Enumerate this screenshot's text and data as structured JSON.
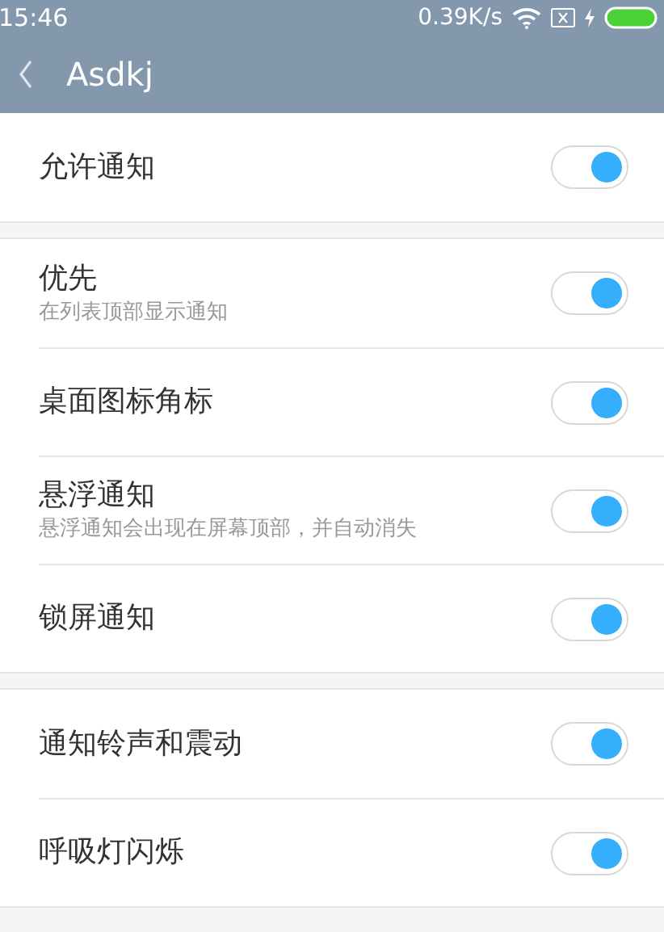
{
  "status_bar": {
    "time": "15:46",
    "speed": "0.39K/s"
  },
  "app_bar": {
    "title": "Asdkj"
  },
  "groups": [
    {
      "rows": [
        {
          "label": "允许通知",
          "on": true
        }
      ]
    },
    {
      "rows": [
        {
          "label": "优先",
          "subtitle": "在列表顶部显示通知",
          "on": true
        },
        {
          "label": "桌面图标角标",
          "on": true
        },
        {
          "label": "悬浮通知",
          "subtitle": "悬浮通知会出现在屏幕顶部，并自动消失",
          "on": true
        },
        {
          "label": "锁屏通知",
          "on": true
        }
      ]
    },
    {
      "rows": [
        {
          "label": "通知铃声和震动",
          "on": true
        },
        {
          "label": "呼吸灯闪烁",
          "on": true
        }
      ]
    }
  ]
}
